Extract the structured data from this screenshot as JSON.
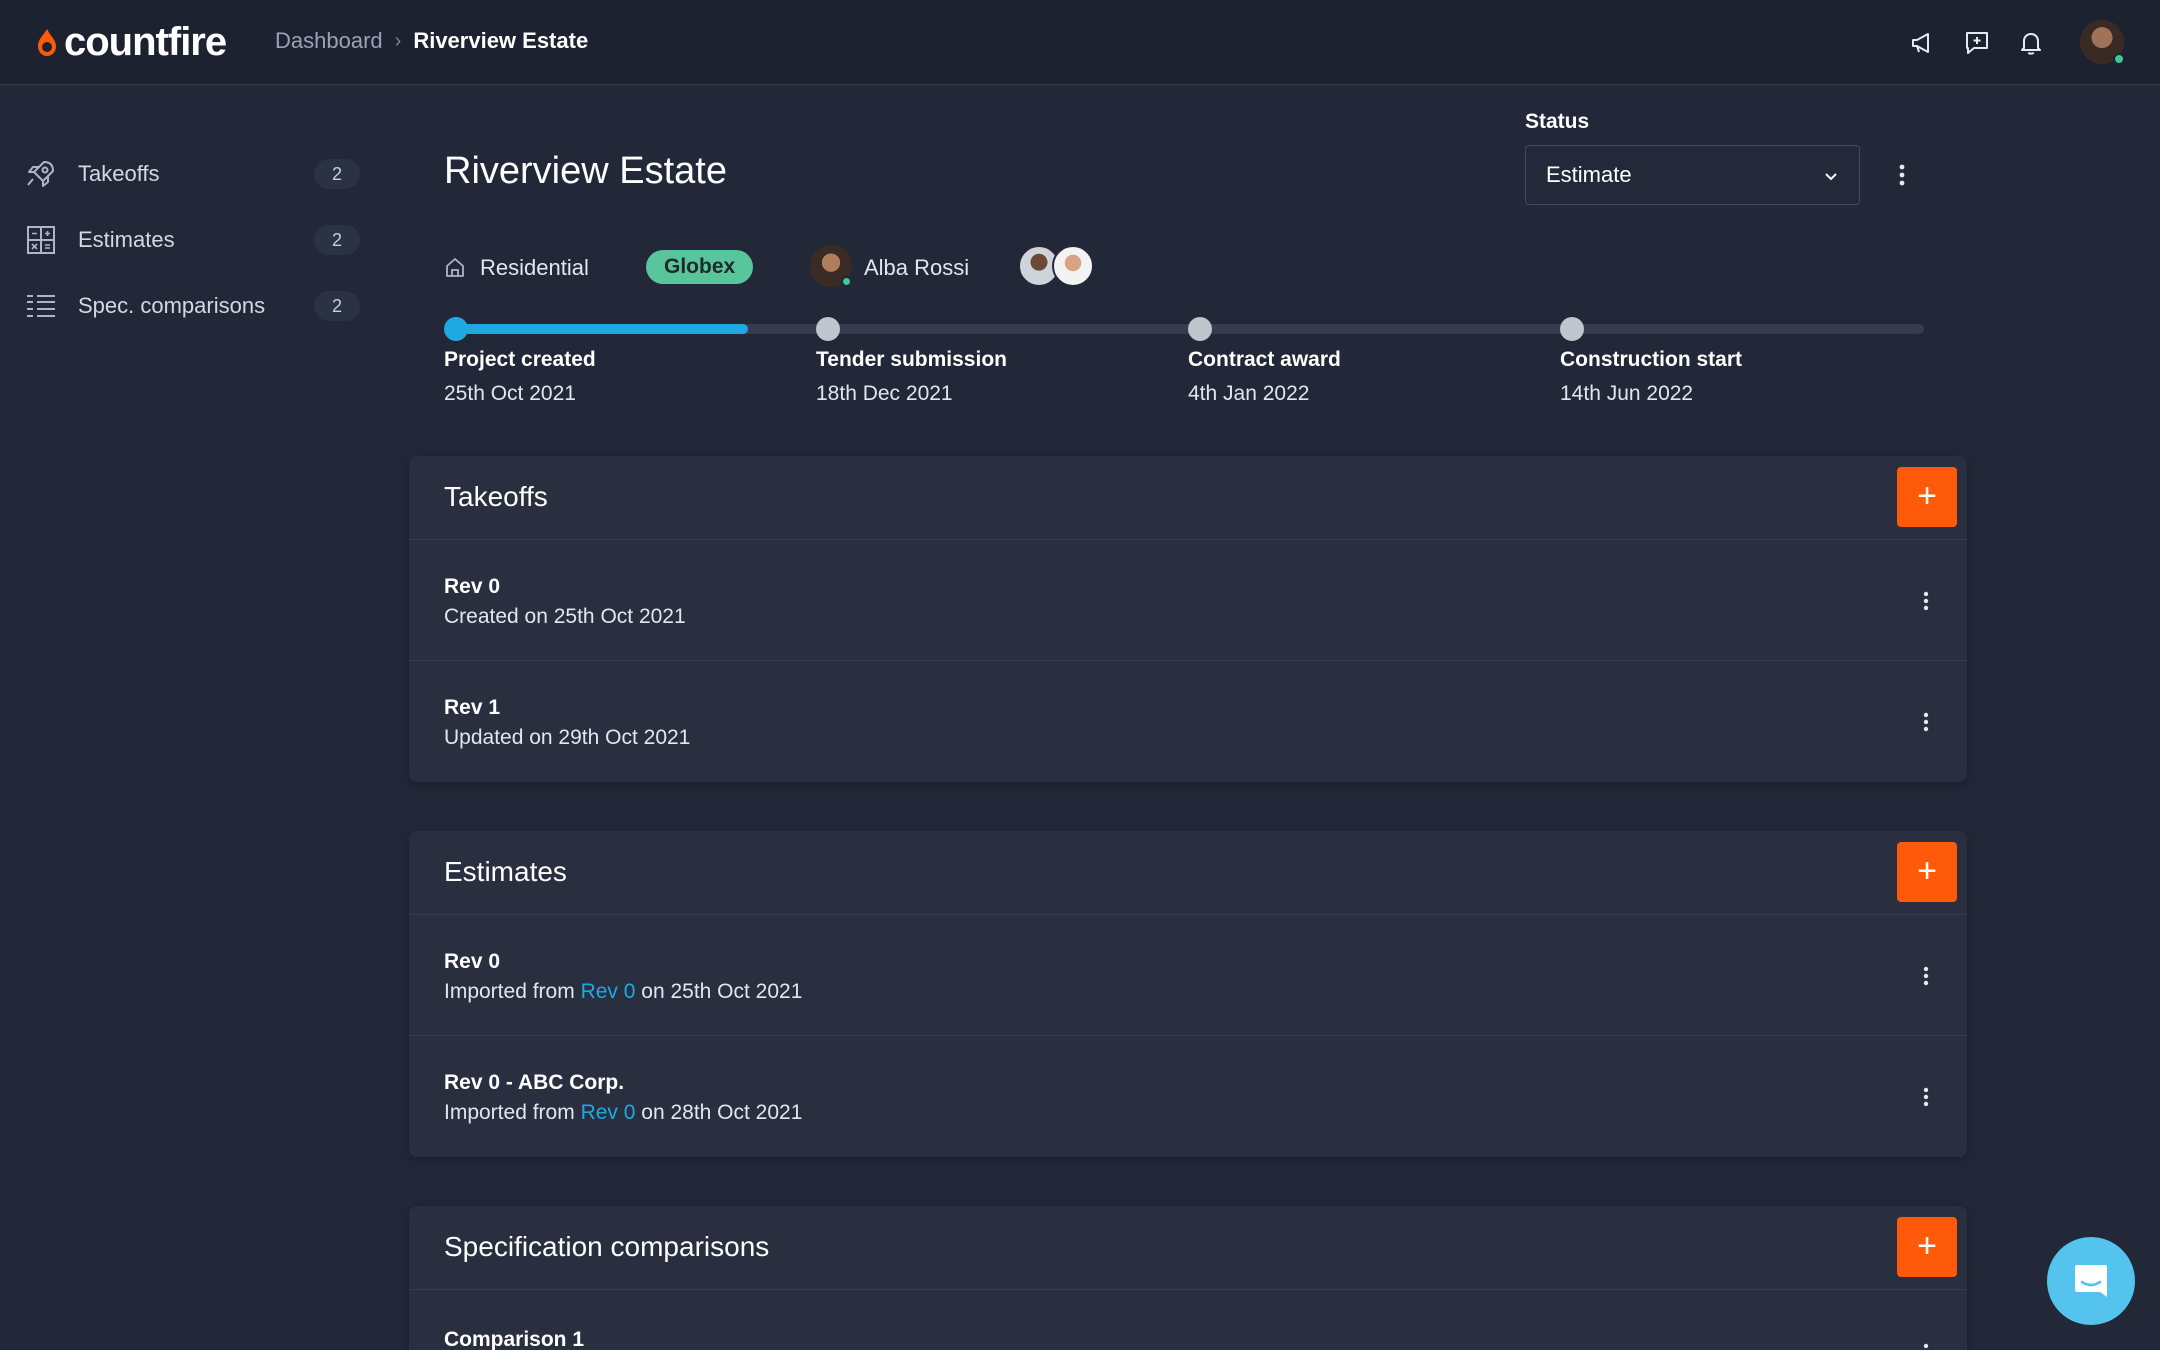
{
  "app": {
    "logo_text": "countfire",
    "brand_color": "#ff5a0a",
    "accent_color": "#1fa9e3"
  },
  "breadcrumb": {
    "parent": "Dashboard",
    "current": "Riverview Estate"
  },
  "header_icons": [
    "megaphone-icon",
    "feedback-icon",
    "bell-icon"
  ],
  "sidebar": {
    "items": [
      {
        "label": "Takeoffs",
        "count": "2",
        "icon": "rocket-icon"
      },
      {
        "label": "Estimates",
        "count": "2",
        "icon": "calculator-icon"
      },
      {
        "label": "Spec. comparisons",
        "count": "2",
        "icon": "list-icon"
      }
    ]
  },
  "project": {
    "title": "Riverview Estate",
    "type": "Residential",
    "client": "Globex",
    "owner": "Alba Rossi",
    "status_label": "Status",
    "status_value": "Estimate",
    "progress_fraction": 0.2
  },
  "timeline": [
    {
      "name": "Project created",
      "date": "25th Oct 2021",
      "done": true
    },
    {
      "name": "Tender submission",
      "date": "18th Dec 2021",
      "done": false
    },
    {
      "name": "Contract award",
      "date": "4th Jan 2022",
      "done": false
    },
    {
      "name": "Construction start",
      "date": "14th Jun 2022",
      "done": false
    }
  ],
  "takeoffs": {
    "title": "Takeoffs",
    "add_label": "+",
    "rows": [
      {
        "title": "Rev 0",
        "sub": "Created on 25th Oct 2021"
      },
      {
        "title": "Rev 1",
        "sub": "Updated on 29th Oct 2021"
      }
    ]
  },
  "estimates": {
    "title": "Estimates",
    "add_label": "+",
    "rows": [
      {
        "title": "Rev 0",
        "prefix": "Imported from",
        "link": "Rev 0",
        "suffix": "on 25th Oct 2021"
      },
      {
        "title": "Rev 0 - ABC Corp.",
        "prefix": "Imported from",
        "link": "Rev 0",
        "suffix": "on 28th Oct 2021"
      }
    ]
  },
  "spec_comparisons": {
    "title": "Specification comparisons",
    "add_label": "+",
    "rows": [
      {
        "title": "Comparison 1"
      }
    ]
  }
}
